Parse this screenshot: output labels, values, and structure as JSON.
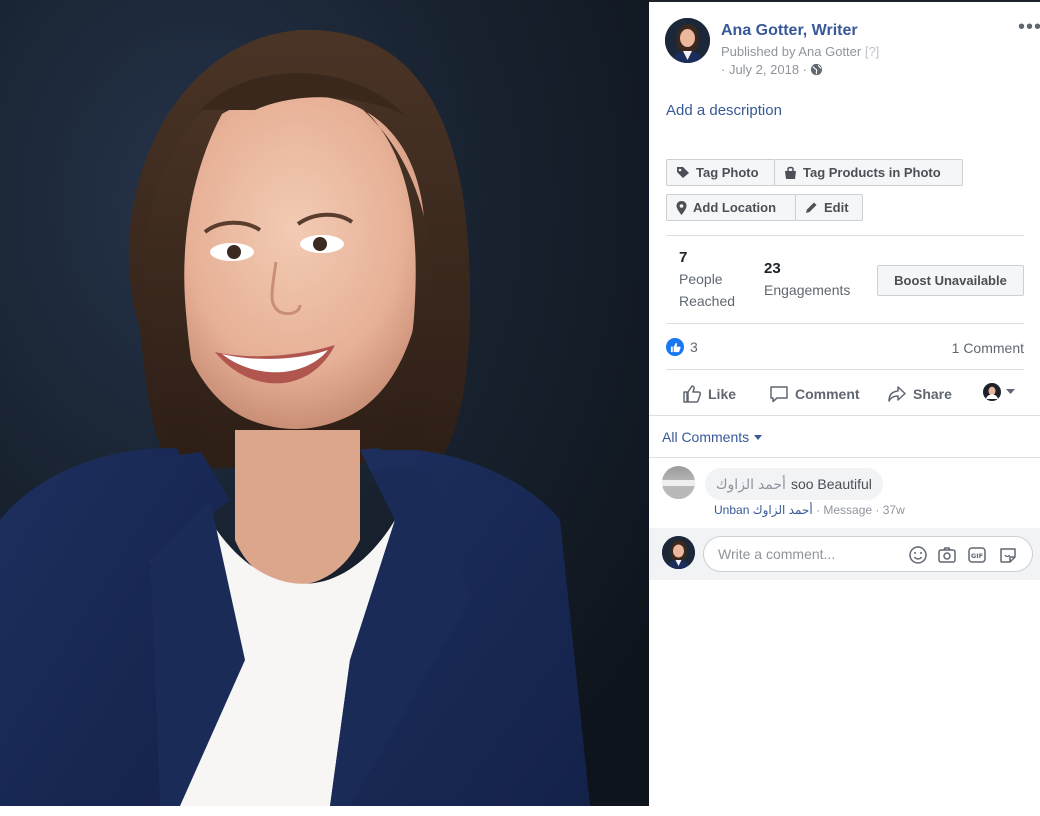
{
  "post": {
    "page_name": "Ana Gotter, Writer",
    "published_by": "Published by Ana Gotter",
    "published_help": "[?]",
    "date": "· July 2, 2018 ·",
    "audience_icon": "globe-icon",
    "more_label": "•••",
    "add_description": "Add a description"
  },
  "actions": {
    "tag_photo": "Tag Photo",
    "tag_products": "Tag Products in Photo",
    "add_location": "Add Location",
    "edit": "Edit"
  },
  "insights": {
    "reached_value": "7",
    "reached_label_1": "People",
    "reached_label_2": "Reached",
    "engagements_value": "23",
    "engagements_label": "Engagements",
    "boost_label": "Boost Unavailable"
  },
  "reactions": {
    "count": "3",
    "comments": "1 Comment"
  },
  "bar": {
    "like": "Like",
    "comment": "Comment",
    "share": "Share"
  },
  "comments": {
    "filter_label": "All Comments",
    "items": [
      {
        "author": "أحمد الزاوك",
        "text": "soo Beautiful",
        "unban": "Unban",
        "author_short": "أحمد الزاوك",
        "message": "· Message ·",
        "age": "37w"
      }
    ],
    "composer_placeholder": "Write a comment..."
  },
  "colors": {
    "link_blue": "#385898",
    "like_blue": "#1877f2",
    "photo_bg": "#18212e"
  }
}
